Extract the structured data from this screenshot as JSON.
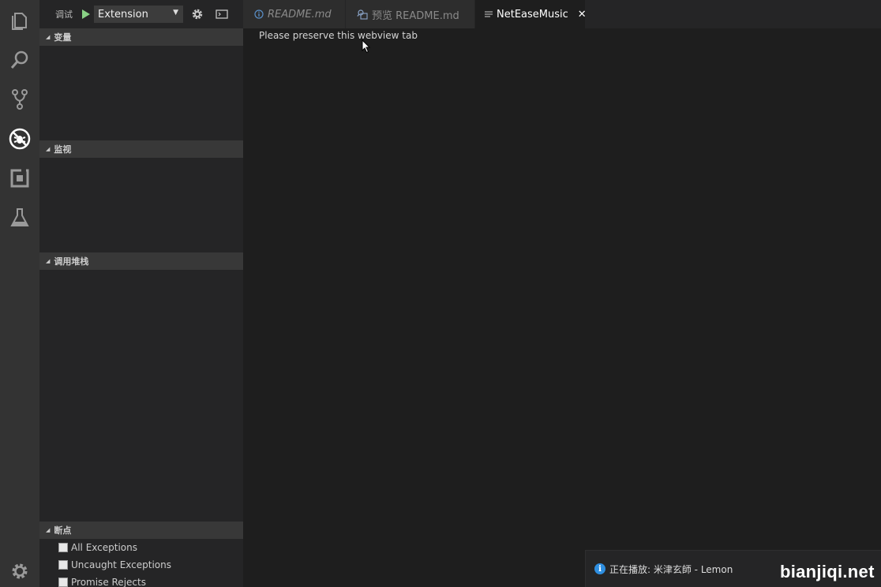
{
  "activity_bar": {
    "items": [
      {
        "name": "explorer-icon"
      },
      {
        "name": "search-icon"
      },
      {
        "name": "source-control-icon"
      },
      {
        "name": "debug-icon"
      },
      {
        "name": "extensions-icon"
      },
      {
        "name": "test-flask-icon"
      }
    ],
    "settings_icon": "gear-icon"
  },
  "debug_toolbar": {
    "title": "调试",
    "config": "Extension",
    "config_arrow": "▼"
  },
  "sidebar": {
    "sections": [
      {
        "label": "变量"
      },
      {
        "label": "监视"
      },
      {
        "label": "调用堆栈"
      },
      {
        "label": "断点"
      }
    ],
    "breakpoints": [
      {
        "label": "All Exceptions",
        "checked": false
      },
      {
        "label": "Uncaught Exceptions",
        "checked": false
      },
      {
        "label": "Promise Rejects",
        "checked": false
      }
    ]
  },
  "tabs": [
    {
      "label": "README.md",
      "icon": "info-icon",
      "active": false
    },
    {
      "label": "预览 README.md",
      "icon": "preview-icon",
      "active": false
    },
    {
      "label": "NetEaseMusic",
      "icon": "lines-icon",
      "active": true,
      "close": "✕"
    }
  ],
  "editor": {
    "text": "Please preserve this webview tab"
  },
  "notification": {
    "icon": "i",
    "message": "正在播放: 米津玄師 - Lemon"
  },
  "watermark": "bianjiqi.net",
  "colors": {
    "activity_bg": "#333333",
    "sidebar_bg": "#252526",
    "editor_bg": "#1e1e1e",
    "run_green": "#89d185",
    "info_blue": "#2e8ee0"
  }
}
